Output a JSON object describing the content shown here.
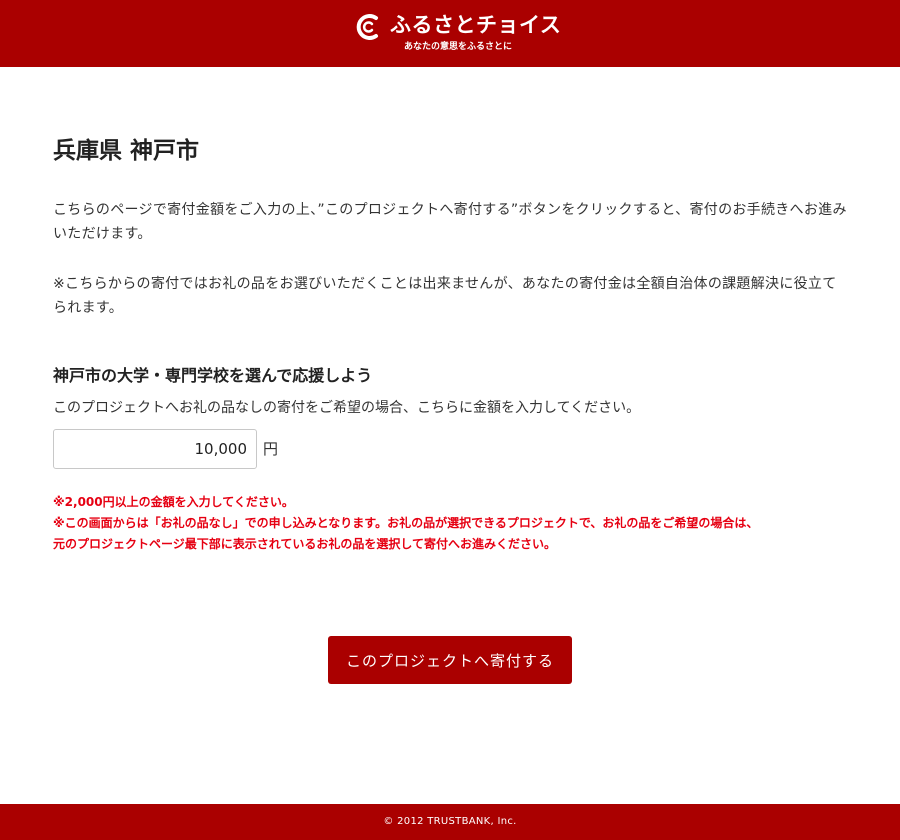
{
  "header": {
    "logo_name": "ふるさとチョイス",
    "logo_tagline": "あなたの意思をふるさとに"
  },
  "main": {
    "page_title": "兵庫県 神戸市",
    "intro_text": "こちらのページで寄付金額をご入力の上、”このプロジェクトへ寄付する”ボタンをクリックすると、寄付のお手続きへお進みいただけます。",
    "note_text": "※こちらからの寄付ではお礼の品をお選びいただくことは出来ませんが、あなたの寄付金は全額自治体の課題解決に役立てられます。",
    "project_title": "神戸市の大学・専門学校を選んで応援しよう",
    "project_desc": "このプロジェクトへお礼の品なしの寄付をご希望の場合、こちらに金額を入力してください。",
    "amount_value": "10,000",
    "amount_unit": "円",
    "warnings": [
      "※2,000円以上の金額を入力してください。",
      "※この画面からは「お礼の品なし」での申し込みとなります。お礼の品が選択できるプロジェクトで、お礼の品をご希望の場合は、",
      "元のプロジェクトページ最下部に表示されているお礼の品を選択して寄付へお進みください。"
    ],
    "donate_button_label": "このプロジェクトへ寄付する"
  },
  "footer": {
    "copyright": "© 2012 TRUSTBANK, Inc."
  },
  "colors": {
    "brand_red": "#aa0000",
    "warning_red": "#e60012"
  },
  "icons": {
    "logo_mark": "furusato-choice-logo-icon"
  }
}
